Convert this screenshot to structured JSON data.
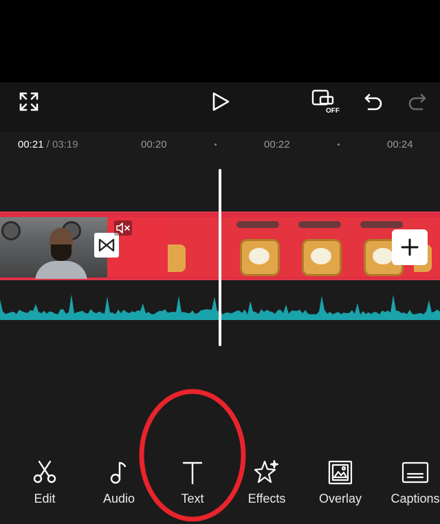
{
  "timeline": {
    "current_time": "00:21",
    "total_time": " / 03:19",
    "ticks": [
      "00:20",
      "00:22",
      "00:24"
    ]
  },
  "toolbar": {
    "edit": "Edit",
    "audio": "Audio",
    "text": "Text",
    "effects": "Effects",
    "overlay": "Overlay",
    "captions": "Captions"
  },
  "icons": {
    "fullscreen": "fullscreen-icon",
    "play": "play-icon",
    "keyframe_off": "keyframe-off-icon",
    "undo": "undo-icon",
    "redo": "redo-icon",
    "transition": "transition-icon",
    "mute": "mute-icon",
    "add": "plus-icon",
    "edit": "scissors-icon",
    "audio": "music-note-icon",
    "text": "text-icon",
    "effects": "sparkle-star-icon",
    "overlay": "overlay-image-icon",
    "captions": "captions-icon"
  },
  "colors": {
    "track_border": "#e0384b",
    "waveform": "#1aa3ab",
    "annotation_ring": "#e8242c"
  }
}
